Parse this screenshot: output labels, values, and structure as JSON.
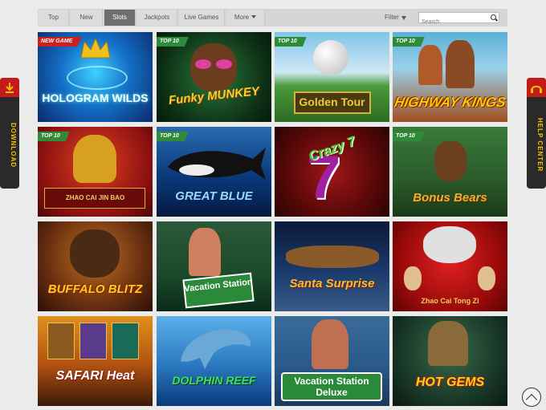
{
  "nav": {
    "tabs": [
      {
        "label": "Top"
      },
      {
        "label": "New"
      },
      {
        "label": "Slots"
      },
      {
        "label": "Jackpots"
      },
      {
        "label": "Live Games"
      },
      {
        "label": "More"
      }
    ],
    "active_tab": "Slots",
    "filter_label": "Filter",
    "search_placeholder": "Search"
  },
  "side": {
    "left_label": "DOWNLOAD",
    "right_label": "HELP CENTER"
  },
  "games": [
    {
      "title": "HOLOGRAM WILDS",
      "badge": "NEW GAME"
    },
    {
      "title": "Funky MUNKEY",
      "badge": "TOP 10"
    },
    {
      "title": "Golden Tour",
      "badge": "TOP 10"
    },
    {
      "title": "HIGHWAY KINGS",
      "badge": "TOP 10"
    },
    {
      "title": "ZHAO CAI JIN BAO",
      "badge": "TOP 10"
    },
    {
      "title": "GREAT BLUE",
      "badge": "TOP 10"
    },
    {
      "title": "Crazy 7",
      "badge": ""
    },
    {
      "title": "Bonus Bears",
      "badge": "TOP 10"
    },
    {
      "title": "BUFFALO BLITZ",
      "badge": ""
    },
    {
      "title": "Vacation Station",
      "badge": ""
    },
    {
      "title": "Santa Surprise",
      "badge": ""
    },
    {
      "title": "Zhao Cai Tong Zi",
      "badge": ""
    },
    {
      "title": "SAFARI Heat",
      "badge": ""
    },
    {
      "title": "DOLPHIN REEF",
      "badge": ""
    },
    {
      "title": "Vacation Station Deluxe",
      "badge": ""
    },
    {
      "title": "HOT GEMS",
      "badge": ""
    }
  ],
  "colors": {
    "top_badge": "#2e8b3a",
    "new_badge": "#cc1f1f",
    "side_panel": "#2a2a2a",
    "side_accent": "#c41a1a",
    "side_text": "#f2c200",
    "active_tab": "#6e6e6e"
  },
  "icons": {
    "filter": "funnel-icon",
    "search": "search-icon",
    "download": "download-icon",
    "help": "help-icon",
    "scroll_top": "chevron-up-icon"
  }
}
